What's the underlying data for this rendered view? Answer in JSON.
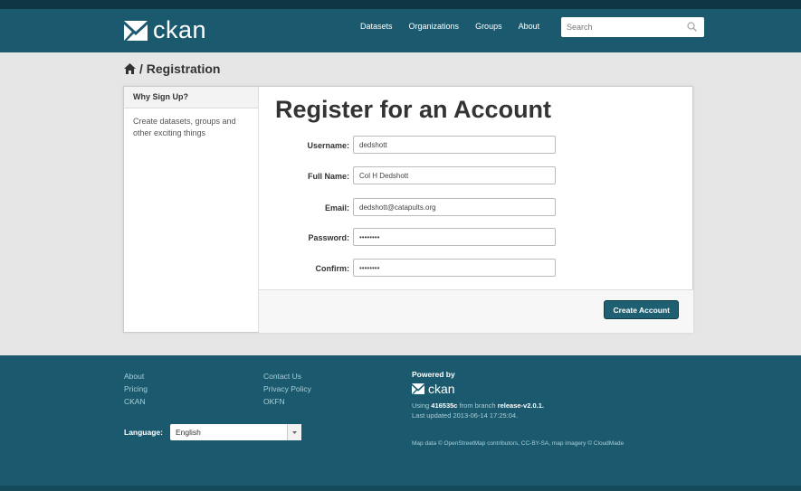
{
  "header": {
    "brand": "ckan",
    "nav": [
      "Datasets",
      "Organizations",
      "Groups",
      "About"
    ],
    "search_placeholder": "Search"
  },
  "breadcrumb": {
    "text": "/ Registration"
  },
  "sidebar": {
    "title": "Why Sign Up?",
    "body": "Create datasets, groups and other exciting things"
  },
  "form": {
    "title": "Register for an Account",
    "fields": [
      {
        "label": "Username:",
        "value": "dedshott"
      },
      {
        "label": "Full Name:",
        "value": "Col H Dedshott"
      },
      {
        "label": "Email:",
        "value": "dedshott@catapults.org"
      },
      {
        "label": "Password:",
        "value": "••••••••"
      },
      {
        "label": "Confirm:",
        "value": "••••••••"
      }
    ],
    "submit_label": "Create Account"
  },
  "footer": {
    "col1": [
      "About",
      "Pricing",
      "CKAN"
    ],
    "col2": [
      "Contact Us",
      "Privacy Policy",
      "OKFN"
    ],
    "language_label": "Language:",
    "language_value": "English",
    "powered_by": "Powered by",
    "brand": "ckan",
    "using_prefix": "Using",
    "commit": "416535c",
    "branch_text": "from branch",
    "branch": "release-v2.0.1.",
    "last_updated": "Last updated 2013-06-14 17:25:04.",
    "map_credit": "Map data © OpenStreetMap contributors, CC-BY-SA, map imagery © CloudMade"
  },
  "colors": {
    "primary": "#1b5a6e",
    "topbar_dark": "#0e3644",
    "button": "#1e5f72",
    "background": "#e6e6e6"
  }
}
